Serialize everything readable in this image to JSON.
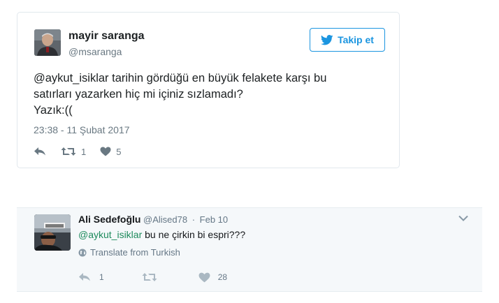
{
  "tweet": {
    "author_name": "mayir saranga",
    "author_handle": "@msaranga",
    "follow_label": "Takip et",
    "text_lines": [
      "@aykut_isiklar tarihin gördüğü en büyük felakete karşı bu",
      "satırları yazarken hiç mi içiniz sızlamadı?",
      "Yazık:(("
    ],
    "timestamp": "23:38 - 11 Şubat 2017",
    "retweet_count": "1",
    "like_count": "5",
    "icons": [
      "reply-icon",
      "retweet-icon",
      "heart-icon",
      "twitter-bird-icon"
    ],
    "accent_color": "#1b95e0"
  },
  "reply": {
    "author_name": "Ali Sedefoğlu",
    "author_handle": "@Alised78",
    "separator": "·",
    "date": "Feb 10",
    "mention": "@aykut_isiklar",
    "text": " bu ne çirkin bi espri???",
    "translate_label": "Translate from Turkish",
    "reply_count": "1",
    "like_count": "28",
    "icons": [
      "reply-icon",
      "retweet-icon",
      "heart-icon",
      "globe-icon",
      "chevron-down-icon"
    ],
    "mention_color": "#1d8a5c"
  }
}
